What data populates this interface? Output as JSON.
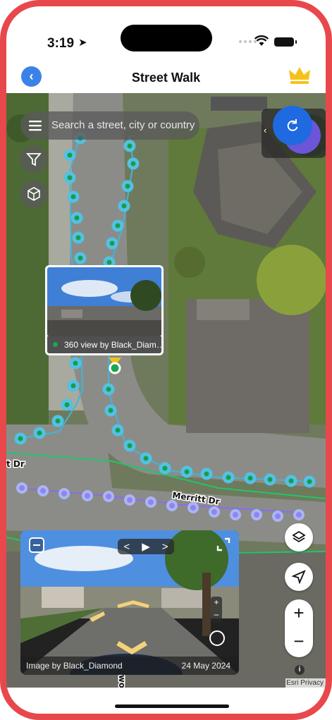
{
  "status_bar": {
    "time": "3:19"
  },
  "header": {
    "title": "Street Walk"
  },
  "search": {
    "placeholder": "Search a street, city or country"
  },
  "map": {
    "street_labels": [
      "t Dr",
      "Merritt Dr",
      "Baywoo"
    ],
    "attribution": "Esri Privacy"
  },
  "photo_popup": {
    "caption": "360 view by Black_Diam…"
  },
  "viewer": {
    "credit": "Image by Black_Diamond",
    "date": "24 May 2024",
    "controls": {
      "prev": "<",
      "play": "▶",
      "next": ">",
      "zoom_in": "+",
      "zoom_out": "–"
    }
  },
  "zoom": {
    "in": "+",
    "out": "−"
  },
  "colors": {
    "accent": "#3b82e8",
    "frame": "#e8484b",
    "trail_green": "#1aa74e",
    "trail_cyan": "#3fb7d6",
    "trail_purple": "#8a6cf0",
    "crown": "#f4c21a"
  },
  "icons": [
    "back-icon",
    "crown-icon",
    "menu-icon",
    "filter-icon",
    "cube-icon",
    "refresh-icon",
    "layers-icon",
    "navigate-icon",
    "expand-icon",
    "info-icon"
  ]
}
